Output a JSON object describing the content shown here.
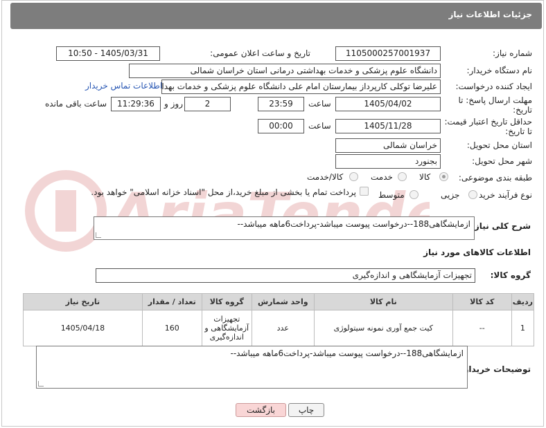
{
  "panel": {
    "title": "جزئیات اطلاعات نیاز"
  },
  "watermark": {
    "brand": "AriaTender.net"
  },
  "need_number": {
    "label": "شماره نیاز:",
    "value": "1105000257001937"
  },
  "announce": {
    "label": "تاریخ و ساعت اعلان عمومی:",
    "value": "1405/03/31 - 10:50"
  },
  "buyer_org": {
    "label": "نام دستگاه خریدار:",
    "value": "دانشگاه علوم پزشکی و خدمات بهداشتی درمانی استان خراسان شمالی"
  },
  "requester": {
    "label": "ایجاد کننده درخواست:",
    "value": "علیرضا توکلی کارپرداز بیمارستان امام علی دانشگاه علوم پزشکی و خدمات بهدا",
    "contact_link": "اطلاعات تماس خریدار"
  },
  "deadline": {
    "label_line1": "مهلت ارسال پاسخ: تا",
    "label_line2": "تاریخ:",
    "date": "1405/04/02",
    "time_label": "ساعت",
    "time": "23:59",
    "days": "2",
    "days_label": "روز و",
    "remaining": "11:29:36",
    "remaining_label": "ساعت باقی مانده"
  },
  "validity": {
    "label_line1": "حداقل تاریخ اعتبار قیمت:",
    "label_line2": "تا تاریخ:",
    "date": "1405/11/28",
    "time_label": "ساعت",
    "time": "00:00"
  },
  "province": {
    "label": "استان محل تحویل:",
    "value": "خراسان شمالی"
  },
  "city": {
    "label": "شهر محل تحویل:",
    "value": "بجنورد"
  },
  "category": {
    "label": "طبقه بندی موضوعی:",
    "options": [
      "کالا",
      "خدمت",
      "کالا/خدمت"
    ],
    "selected": "کالا"
  },
  "purchase": {
    "label": "نوع فرآیند خرید :",
    "options": [
      "جزیی",
      "متوسط"
    ],
    "note": "پرداخت تمام یا بخشی از مبلغ خرید،از محل \"اسناد خزانه اسلامی\" خواهد بود."
  },
  "description": {
    "label": "شرح کلی نیاز:",
    "value": "ازمایشگاهی188--درخواست پیوست میباشد-پرداخت6ماهه میباشد--"
  },
  "goods_section": {
    "title": "اطلاعات کالاهای مورد نیاز"
  },
  "goods_group": {
    "label": "گروه کالا:",
    "value": "تجهیزات آزمایشگاهی و اندازه‌گیری"
  },
  "table": {
    "headers": [
      "ردیف",
      "کد کالا",
      "نام کالا",
      "واحد شمارش",
      "گروه کالا",
      "تعداد / مقدار",
      "تاریخ نیاز"
    ],
    "rows": [
      {
        "row": "1",
        "code": "--",
        "name": "کیت جمع آوری نمونه سیتولوژی",
        "unit": "عدد",
        "group": "تجهیزات آزمایشگاهی و اندازه‌گیری",
        "qty": "160",
        "date": "1405/04/18"
      }
    ]
  },
  "buyer_notes": {
    "label": "توضیحات خریدار:",
    "value": "ازمایشگاهی188--درخواست پیوست میباشد-پرداخت6ماهه میباشد--"
  },
  "buttons": {
    "print": "چاپ",
    "back": "بازگشت"
  },
  "colors": {
    "panel": "#7d7d7d",
    "table_header": "#d8d8d8",
    "back_button": "#f9d6d6",
    "link": "#2756b3"
  }
}
